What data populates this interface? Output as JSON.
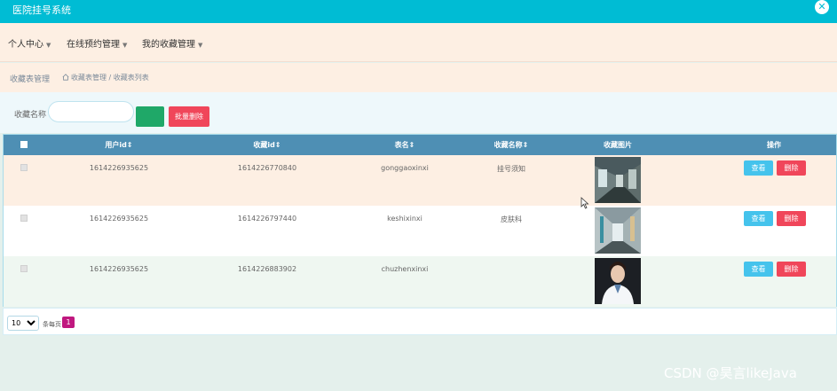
{
  "app": {
    "title": "医院挂号系统",
    "fullscreen_icon": "fullscreen-icon"
  },
  "nav": {
    "items": [
      {
        "label": "个人中心"
      },
      {
        "label": "在线预约管理"
      },
      {
        "label": "我的收藏管理"
      }
    ]
  },
  "breadcrumb": {
    "title": "收藏表管理",
    "path": "收藏表管理 / 收藏表列表"
  },
  "search": {
    "label": "收藏名称",
    "value": "",
    "placeholder": "",
    "search_button": "",
    "bulk_delete": "批量删除"
  },
  "table": {
    "columns": [
      "用户id",
      "收藏id",
      "表名",
      "收藏名称",
      "收藏图片",
      "操作"
    ],
    "rows": [
      {
        "user_id": "1614226935625",
        "fav_id": "1614226770840",
        "table_name": "gonggaoxinxi",
        "fav_name": "挂号须知",
        "image": "hospital-corridor-photo"
      },
      {
        "user_id": "1614226935625",
        "fav_id": "1614226797440",
        "table_name": "keshixinxi",
        "fav_name": "皮肤科",
        "image": "hospital-hallway-photo"
      },
      {
        "user_id": "1614226935625",
        "fav_id": "1614226883902",
        "table_name": "chuzhenxinxi",
        "fav_name": "",
        "image": "doctor-portrait-photo"
      }
    ],
    "view_label": "查看",
    "delete_label": "删除"
  },
  "pager": {
    "page_size": "10",
    "page_size_options": [
      "10"
    ],
    "page_size_label": "条每页",
    "current_page": "1"
  },
  "watermark": "CSDN @昊言likeJava",
  "colors": {
    "topbar": "#00bcd4",
    "nav_bg": "#fdefe3",
    "table_header": "#4e8fb4",
    "view_btn": "#45c3ec",
    "delete_btn": "#f0465a",
    "search_btn": "#1fa868",
    "page_active": "#c0187f"
  }
}
